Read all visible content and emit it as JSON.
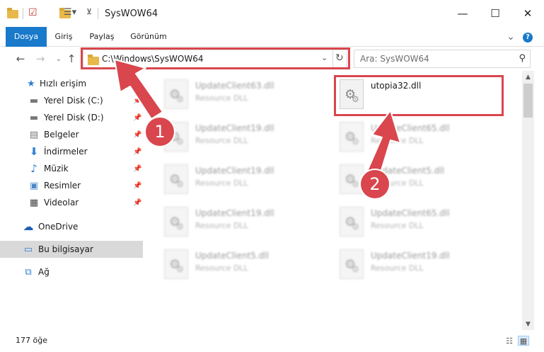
{
  "window": {
    "title": "SysWOW64",
    "minimize_glyph": "—",
    "maximize_glyph": "☐",
    "close_glyph": "✕"
  },
  "ribbon": {
    "tabs": [
      {
        "label": "Dosya",
        "active": true
      },
      {
        "label": "Giriş"
      },
      {
        "label": "Paylaş"
      },
      {
        "label": "Görünüm"
      }
    ],
    "expand_glyph": "⌄",
    "help_glyph": "?"
  },
  "address": {
    "path": "C:\\Windows\\SysWOW64",
    "search_placeholder": "Ara: SysWOW64"
  },
  "sidebar": {
    "items": [
      {
        "label": "Hızlı erişim",
        "icon": "star-icon"
      },
      {
        "label": "Yerel Disk (C:)",
        "icon": "drive-icon",
        "pinned": true
      },
      {
        "label": "Yerel Disk (D:)",
        "icon": "drive-icon",
        "pinned": true
      },
      {
        "label": "Belgeler",
        "icon": "documents-icon",
        "pinned": true
      },
      {
        "label": "İndirmeler",
        "icon": "download-icon",
        "pinned": true
      },
      {
        "label": "Müzik",
        "icon": "music-icon",
        "pinned": true
      },
      {
        "label": "Resimler",
        "icon": "pictures-icon",
        "pinned": true
      },
      {
        "label": "Videolar",
        "icon": "videos-icon",
        "pinned": true
      },
      {
        "label": "OneDrive",
        "icon": "cloud-icon"
      },
      {
        "label": "Bu bilgisayar",
        "icon": "computer-icon",
        "selected": true
      },
      {
        "label": "Ağ",
        "icon": "network-icon"
      }
    ]
  },
  "files": [
    {
      "name": "UpdateClient63.dll",
      "type": "Resource DLL"
    },
    {
      "name": "utopia32.dll",
      "type": ""
    },
    {
      "name": "UpdateClient19.dll",
      "type": "Resource DLL"
    },
    {
      "name": "UpdateClient65.dll",
      "type": "Resource DLL"
    },
    {
      "name": "UpdateClient19.dll",
      "type": "Resource DLL"
    },
    {
      "name": "UpdateClient5.dll",
      "type": "Resource DLL"
    },
    {
      "name": "UpdateClient19.dll",
      "type": "Resource DLL"
    },
    {
      "name": "UpdateClient65.dll",
      "type": "Resource DLL"
    },
    {
      "name": "UpdateClient5.dll",
      "type": "Resource DLL"
    },
    {
      "name": "UpdateClient19.dll",
      "type": "Resource DLL"
    }
  ],
  "status": {
    "item_count": "177 öğe"
  },
  "annotations": {
    "step1": "1",
    "step2": "2",
    "color": "#d9464d"
  }
}
